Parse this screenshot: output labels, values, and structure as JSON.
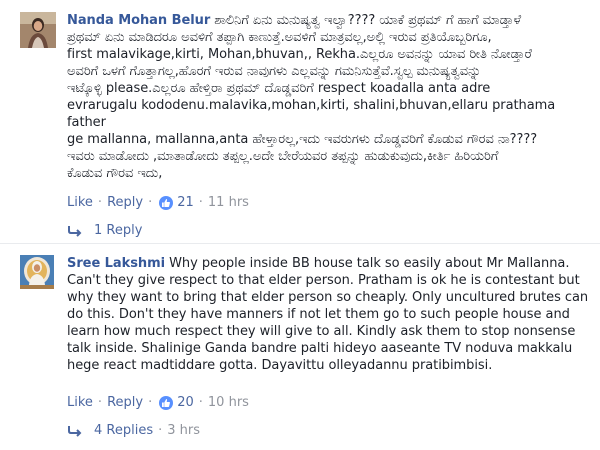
{
  "comments": [
    {
      "author": "Nanda Mohan Belur",
      "text": " ಶಾಲಿನಿಗೆ ಏನು ಮನುಷ್ಯತ್ವ ಇಲ್ವಾ???? ಯಾಕೆ ಪ್ರಥಮ್ ಗೆ ಹಾಗೆ ಮಾಡ್ತಾಳೆ\nಪ್ರಥಮ್ ಏನು ಮಾಡಿದರೂ ಅವಳಿಗೆ ತಪ್ಪಾಗಿ ಕಾಣುತ್ತೆ.ಅವಳಿಗೆ ಮಾತ್ರವಲ್ಲ,ಅಲ್ಲಿ ಇರುವ ಪ್ರತಿಯೊಬ್ಬರಿಗೂ,\nfirst malavikage,kirti, Mohan,bhuvan,, Rekha.ಎಲ್ಲರೂ ಅವನನ್ನು ಯಾವ ರೀತಿ ನೋಡ್ತಾರೆ\nಅವರಿಗೆ ಒಳಗೆ ಗೊತ್ತಾಗಲ್ಲ,ಹೊರಗೆ ಇರುವ ನಾವುಗಳು ಎಲ್ಲವನ್ನು ಗಮನಿಸುತ್ತೆವೆ.ಸ್ವಲ್ಪ ಮನುಷ್ಯತ್ವವನ್ನು\nಇಟ್ಕೊಳ್ಳಿ please.ಎಲ್ಲರೂ ಹೇಳ್ತಿರಾ ಪ್ರಥಮ್ ದೊಡ್ಡವರಿಗೆ respect koadalla anta adre\nevrarugalu kododenu.malavika,mohan,kirti, shalini,bhuvan,ellaru prathama father\nge mallanna, mallanna,anta ಹೇಳ್ತಾರಲ್ಲ,ಇದು ಇವರುಗಳು ದೊಡ್ಡವರಿಗೆ ಕೊಡುವ ಗೌರವ ನಾ????\nಇವರು ಮಾಡೋದು ,ಮಾತಾಡೋದು ತಪ್ಪಲ್ಲ.ಅದೇ ಬೇರೆಯವರ ತಪ್ಪನ್ನು ಹುಡುಕುವುದು,ಕೀರ್ತಿ ಹಿರಿಯರಿಗೆ\nಕೊಡುವ ಗೌರವ ಇದು,",
      "like_label": "Like",
      "reply_label": "Reply",
      "likes": "21",
      "time": "11 hrs",
      "replies_label": "1 Reply",
      "replies_time": ""
    },
    {
      "author": "Sree Lakshmi",
      "text": " Why people inside BB house talk so easily about Mr Mallanna.\nCan't they give respect to that elder person. Pratham is ok he is contestant but\nwhy they want to bring that elder person so cheaply. Only uncultured brutes can\ndo this. Don't they have manners if not let them go to such people house and\nlearn how much respect they will give to all. Kindly ask them to stop nonsense\ntalk inside. Shalinige Ganda bandre palti hideyo aaseante TV noduva makkalu\nhege react madtiddare gotta. Dayavittu olleyadannu pratibimbisi.",
      "like_label": "Like",
      "reply_label": "Reply",
      "likes": "20",
      "time": "10 hrs",
      "replies_label": "4 Replies",
      "replies_time": "3 hrs"
    }
  ],
  "colors": {
    "link": "#4b67a1",
    "author": "#365899",
    "meta": "#90949c",
    "like_badge": "#5890ff"
  }
}
